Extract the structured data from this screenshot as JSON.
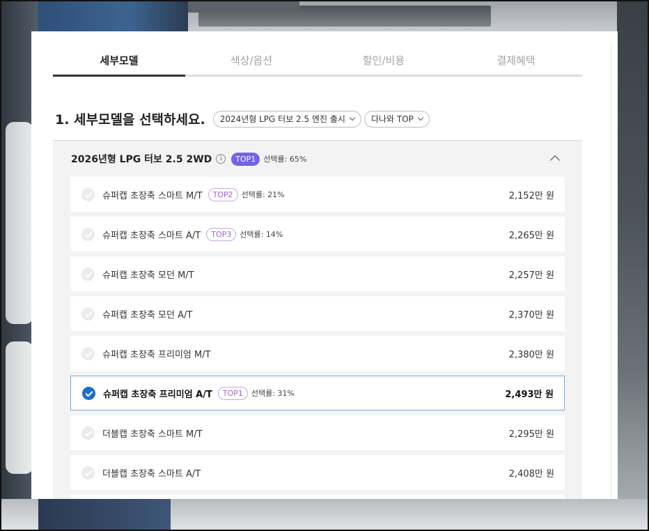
{
  "tabs": [
    {
      "label": "세부모델",
      "active": true
    },
    {
      "label": "색상/옵션",
      "active": false
    },
    {
      "label": "할인/비용",
      "active": false
    },
    {
      "label": "결제혜택",
      "active": false
    }
  ],
  "section": {
    "title": "1. 세부모델을 선택하세요.",
    "filter_year": "2024년형 LPG 터보 2.5 엔진 출시",
    "filter_sort": "다나와 TOP"
  },
  "group": {
    "title": "2026년형 LPG 터보 2.5 2WD",
    "info_icon": "i",
    "badge": "TOP1",
    "rate": "선택률: 65%"
  },
  "trims": [
    {
      "name": "슈퍼캡 초장축 스마트 M/T",
      "badge": "TOP2",
      "rate": "선택률: 21%",
      "price": "2,152만 원",
      "selected": false
    },
    {
      "name": "슈퍼캡 초장축 스마트 A/T",
      "badge": "TOP3",
      "rate": "선택률: 14%",
      "price": "2,265만 원",
      "selected": false
    },
    {
      "name": "슈퍼캡 초장축 모던 M/T",
      "badge": "",
      "rate": "",
      "price": "2,257만 원",
      "selected": false
    },
    {
      "name": "슈퍼캡 초장축 모던 A/T",
      "badge": "",
      "rate": "",
      "price": "2,370만 원",
      "selected": false
    },
    {
      "name": "슈퍼캡 초장축 프리미엄 M/T",
      "badge": "",
      "rate": "",
      "price": "2,380만 원",
      "selected": false
    },
    {
      "name": "슈퍼캡 초장축 프리미엄 A/T",
      "badge": "TOP1",
      "rate": "선택률: 31%",
      "price": "2,493만 원",
      "selected": true
    },
    {
      "name": "더블캡 초장축 스마트 M/T",
      "badge": "",
      "rate": "",
      "price": "2,295만 원",
      "selected": false
    },
    {
      "name": "더블캡 초장축 스마트 A/T",
      "badge": "",
      "rate": "",
      "price": "2,408만 원",
      "selected": false
    }
  ],
  "colors": {
    "accent": "#7264e6",
    "selected": "#1d6ec8",
    "badge_outline": "#9b62c9"
  }
}
